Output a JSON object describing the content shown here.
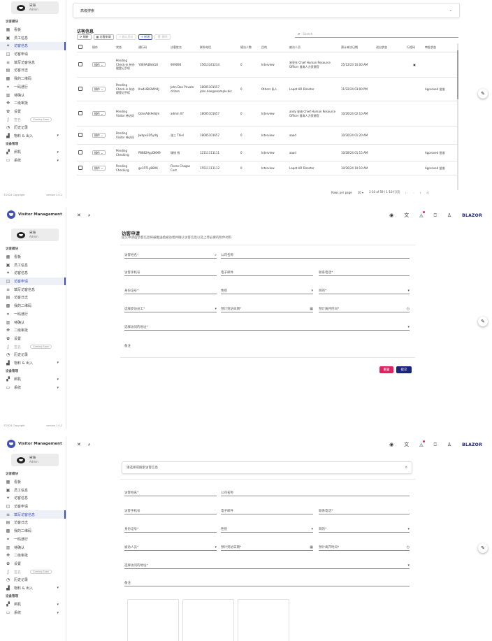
{
  "sidebar": {
    "app_name": "Visitor Management",
    "user_name": "宋海",
    "user_role": "Admin",
    "section_main": "访客模块",
    "items": [
      {
        "icon": "dashboard-icon",
        "glyph": "▦",
        "label": "看板"
      },
      {
        "icon": "badge-icon",
        "glyph": "▣",
        "label": "员工信息"
      },
      {
        "icon": "walk-icon",
        "glyph": "✦",
        "label": "访客信息"
      },
      {
        "icon": "form-icon",
        "glyph": "◫",
        "label": "访客申请"
      },
      {
        "icon": "edit-list-icon",
        "glyph": "≡",
        "label": "填写访客信息"
      },
      {
        "icon": "doc-icon",
        "glyph": "▤",
        "label": "访客日志"
      },
      {
        "icon": "qr-icon",
        "glyph": "▩",
        "label": "我的二维码"
      },
      {
        "icon": "qr-scan-icon",
        "glyph": "⌗",
        "label": "一码通行"
      },
      {
        "icon": "keyboard-icon",
        "glyph": "▥",
        "label": "待确认"
      },
      {
        "icon": "network-icon",
        "glyph": "✥",
        "label": "二级审批"
      },
      {
        "icon": "settings-icon",
        "glyph": "✿",
        "label": "设置"
      },
      {
        "icon": "signature-icon",
        "glyph": "∫",
        "label": "签名",
        "badge": "Coming Soon"
      },
      {
        "icon": "history-icon",
        "glyph": "◔",
        "label": "历史记录"
      },
      {
        "icon": "factory-icon",
        "glyph": "▟",
        "label": "物料 & 出入",
        "chevron": "▾"
      }
    ],
    "section_devices": "设备管理",
    "device_items": [
      {
        "icon": "device-icon",
        "glyph": "▞",
        "label": "闸机",
        "chevron": "▾"
      },
      {
        "icon": "monitor-icon",
        "glyph": "▭",
        "label": "系统",
        "chevron": "▾"
      }
    ],
    "footer_copyright": "©2024 Copyright",
    "footer_version": "version 1.0.2"
  },
  "topbar": {
    "close_glyph": "✕",
    "search_glyph": "⌕",
    "github_glyph": "◉",
    "translate_glyph": "文",
    "bell_glyph": "◬",
    "apps_glyph": "⍞",
    "account_glyph": "♙",
    "brand": "BLAZOR"
  },
  "panel1": {
    "advanced_search_label": "高级搜索",
    "list_title": "访客信息",
    "toolbar": {
      "refresh": "⟳ 刷新",
      "apply": "▦ 访客申请",
      "visit_confirm": "⚇ 确认到访",
      "add": "+ 新增",
      "delete": "🗑 删除"
    },
    "search_placeholder": "Search",
    "columns": [
      "操作",
      "状态",
      "通行码",
      "访客姓名",
      "联系电话",
      "随访人数",
      "目的",
      "被访人员",
      "预计来访日期",
      "进出状态",
      "行程码",
      "审批状态"
    ],
    "rows": [
      {
        "op": "操作 ⌄",
        "status": "Pending Check-in 待办理登记手续",
        "pass": "Y0II9A4Bdk18",
        "name": "909090",
        "phone": "15613341234",
        "count": "0",
        "purpose": "Interview",
        "host": "宋亚东 Chief Human Resource Officer 首席人力资源官",
        "date": "25/12/23 10:00 AM",
        "io": "",
        "trip": "▣",
        "approval": ""
      },
      {
        "op": "操作 ⌄",
        "status": "Pending Check-in 待办理登记手续",
        "pass": "Iho4HEK2Wh9J",
        "name": "John Doe Private citizen",
        "phone": "18005101557 john.doe@example.biz",
        "count": "0",
        "purpose": "Others 私人",
        "host": "Lapet HR Director",
        "date": "11/22/24 03:00 PM",
        "io": "",
        "trip": "",
        "approval": "Approved 批准"
      },
      {
        "op": "操作 ⌄",
        "status": "Pending Visitor 待访问",
        "pass": "QdvsAdk9eSJm",
        "name": "admin 07",
        "phone": "18005101657",
        "count": "0",
        "purpose": "Interview",
        "host": "andy 安迪 Chief Human Resource Officer 首席人力资源官",
        "date": "10/26/24 02:10 AM",
        "io": "",
        "trip": "",
        "approval": ""
      },
      {
        "op": "操作 ⌄",
        "status": "Pending Visitor 待访问",
        "pass": "Jwbpx3D5ydzj",
        "name": "张三 Thiel",
        "phone": "18005101657",
        "count": "0",
        "purpose": "Interview",
        "host": "aaad",
        "date": "10/30/24 01:20 AM",
        "io": "",
        "trip": "",
        "approval": ""
      },
      {
        "op": "操作 ⌄",
        "status": "Pending Checking",
        "pass": "P8882AypDKM9",
        "name": "瑞钱 钱",
        "phone": "12111111111",
        "count": "0",
        "purpose": "Interview",
        "host": "aaad",
        "date": "10/28/24 01:15 AM",
        "io": "",
        "trip": "",
        "approval": "Approved 批准"
      },
      {
        "op": "操作 ⌄",
        "status": "Pending Checking",
        "pass": "gx1P71yB8XK",
        "name": "Flores Chagas Cost",
        "phone": "15511111112",
        "count": "0",
        "purpose": "Interview",
        "host": "Lapet HR Director",
        "date": "10/26/24 10:10 AM",
        "io": "",
        "trip": "",
        "approval": "Approved 批准"
      }
    ],
    "pager": {
      "rows_per_page_label": "Rows per page",
      "rows_per_page_value": "10",
      "range": "1-10 of 59 / 1-10 行/页",
      "first": "|‹",
      "prev": "‹",
      "next": "›",
      "last": "›|"
    }
  },
  "panel2": {
    "title": "访客申请",
    "subtitle": "提交申请后访客信息将被推送给被访者并确认访客信息以及上传必要的附件材料",
    "fields": {
      "visitor_name": "访客姓名*",
      "company": "公司名称",
      "visitor_phone": "访客手机号",
      "email": "电子邮件",
      "id_number": "联系电话*",
      "id_card": "身份证号*",
      "gender": "性别",
      "purpose": "目的*",
      "host_employee": "选择受访员工*",
      "visit_date": "预计到访日期*",
      "leave_date": "预计离开时间*",
      "visit_location": "选择访问的地址*",
      "remark": "备注"
    },
    "reset_button": "重置",
    "submit_button": "提交"
  },
  "panel3": {
    "search_placeholder": "请选择或搜索访客信息",
    "fields": {
      "visitor_name": "访客姓名*",
      "company": "公司名称",
      "visitor_phone": "访客手机号",
      "email": "电子邮件",
      "contact_phone": "联系电话*",
      "id_card": "身份证号*",
      "gender": "性别",
      "purpose": "目的*",
      "host_person": "被访人员*",
      "visit_date": "预计到访日期*",
      "leave_date": "预计离开时间*",
      "visit_location": "选择访问的地址*",
      "remark": "备注"
    }
  }
}
